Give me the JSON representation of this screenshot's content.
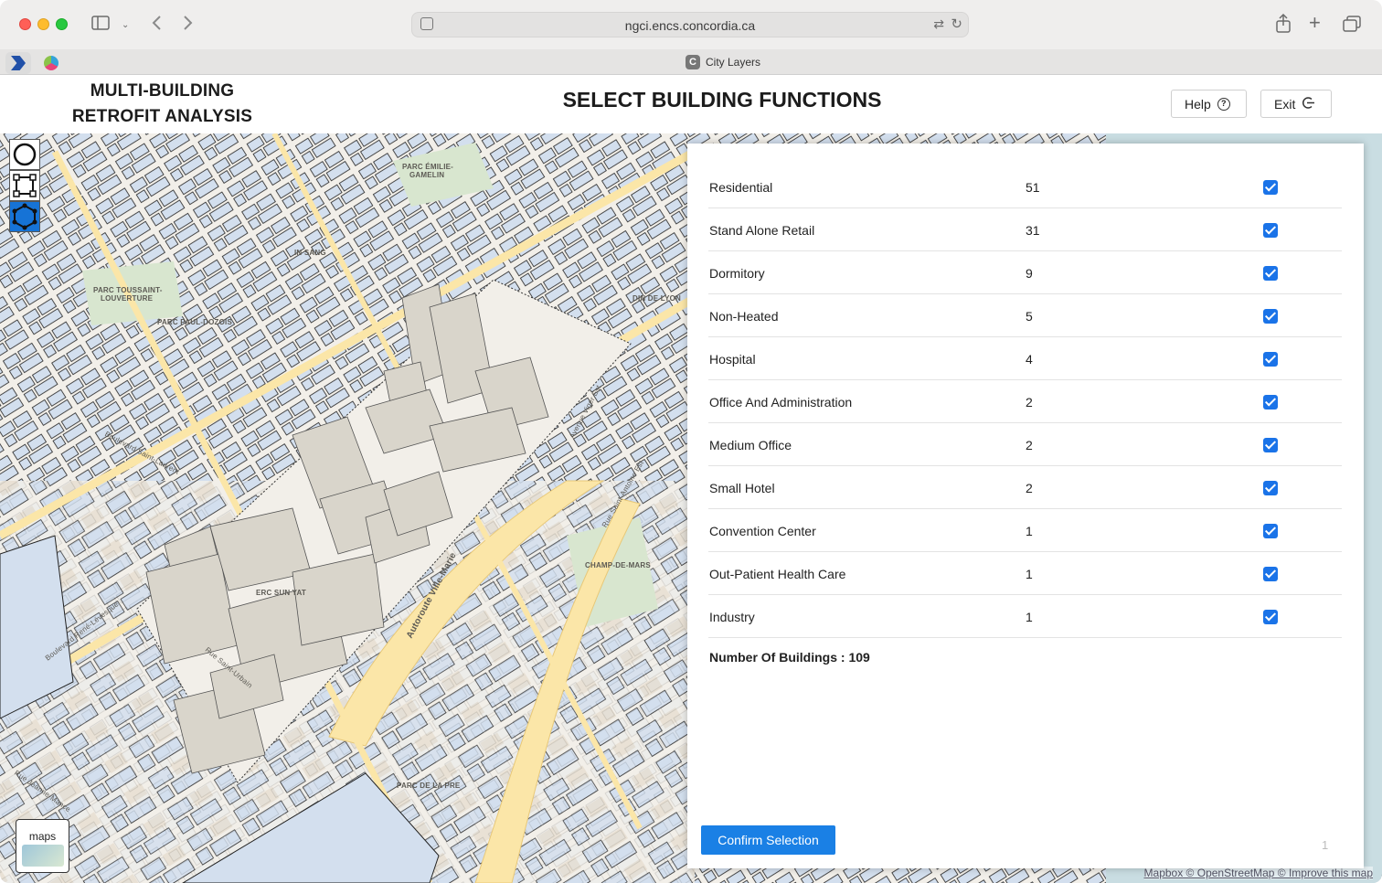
{
  "browser": {
    "url": "ngci.encs.concordia.ca",
    "tab_title": "City Layers",
    "tab_favicon_letter": "C"
  },
  "header": {
    "app_title_line1": "MULTI-BUILDING",
    "app_title_line2": "RETROFIT ANALYSIS",
    "page_heading": "SELECT BUILDING FUNCTIONS",
    "help_label": "Help",
    "exit_label": "Exit"
  },
  "map": {
    "labels": [
      "PARC ÉMILIE-",
      "GAMELIN",
      "PARC TOUSSAINT-",
      "LOUVERTURE",
      "PARC PAUL-DOZOIS",
      "IN SANG",
      "ERC SUN YAT",
      "CHAMP-DE-MARS",
      "PARC DE LA PRE",
      "DIN DE LYON",
      "Boulevard Saint-Laurent",
      "Boulevard René-Lévesque",
      "Autoroute Ville-Marie",
      "Rue Saint-Antoine Est",
      "Avenue Viger Est",
      "Rue Saint-Urbain",
      "Rue Jeanne-Mance"
    ],
    "minimap_label": "maps",
    "attribution": "Mapbox © OpenStreetMap © Improve this map"
  },
  "panel": {
    "functions": [
      {
        "name": "Residential",
        "count": "51",
        "checked": true
      },
      {
        "name": "Stand Alone Retail",
        "count": "31",
        "checked": true
      },
      {
        "name": "Dormitory",
        "count": "9",
        "checked": true
      },
      {
        "name": "Non-Heated",
        "count": "5",
        "checked": true
      },
      {
        "name": "Hospital",
        "count": "4",
        "checked": true
      },
      {
        "name": "Office And Administration",
        "count": "2",
        "checked": true
      },
      {
        "name": "Medium Office",
        "count": "2",
        "checked": true
      },
      {
        "name": "Small Hotel",
        "count": "2",
        "checked": true
      },
      {
        "name": "Convention Center",
        "count": "1",
        "checked": true
      },
      {
        "name": "Out-Patient Health Care",
        "count": "1",
        "checked": true
      },
      {
        "name": "Industry",
        "count": "1",
        "checked": true
      }
    ],
    "total_label": "Number Of Buildings : 109",
    "confirm_label": "Confirm Selection",
    "page_number": "1"
  },
  "colors": {
    "accent": "#1a80e5",
    "checkbox": "#1a73e8",
    "building_2d": "#d3dfee",
    "building_3d": "#d9d5cb",
    "road": "#fbe6a8",
    "park": "#d8e6cf",
    "map_bg": "#f2efe9"
  }
}
